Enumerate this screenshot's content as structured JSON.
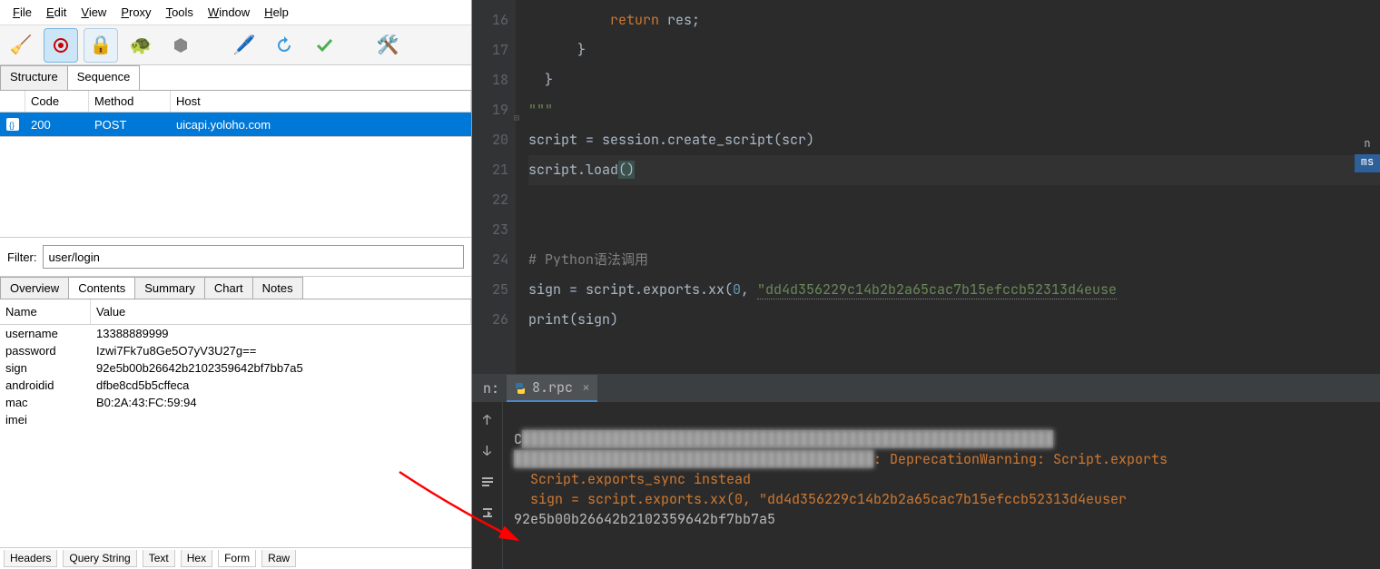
{
  "menu": [
    "File",
    "Edit",
    "View",
    "Proxy",
    "Tools",
    "Window",
    "Help"
  ],
  "toolbar_icons": [
    "broom",
    "record",
    "lock",
    "turtle",
    "hex",
    "pencil",
    "refresh",
    "check",
    "wrench"
  ],
  "view_tabs": {
    "items": [
      "Structure",
      "Sequence"
    ],
    "selected": 1
  },
  "request_table": {
    "columns": {
      "code": "Code",
      "method": "Method",
      "host": "Host"
    },
    "rows": [
      {
        "code": "200",
        "method": "POST",
        "host": "uicapi.yoloho.com"
      }
    ]
  },
  "filter": {
    "label": "Filter:",
    "value": "user/login"
  },
  "detail_tabs": {
    "items": [
      "Overview",
      "Contents",
      "Summary",
      "Chart",
      "Notes"
    ],
    "selected": 1
  },
  "nv_table": {
    "columns": {
      "name": "Name",
      "value": "Value"
    },
    "rows": [
      {
        "name": "username",
        "value": "13388889999"
      },
      {
        "name": "password",
        "value": "Izwi7Fk7u8Ge5O7yV3U27g=="
      },
      {
        "name": "sign",
        "value": "92e5b00b26642b2102359642bf7bb7a5"
      },
      {
        "name": "androidid",
        "value": "dfbe8cd5b5cffeca"
      },
      {
        "name": "mac",
        "value": "B0:2A:43:FC:59:94"
      },
      {
        "name": "imei",
        "value": ""
      }
    ]
  },
  "bottom_tabs": {
    "items": [
      "Headers",
      "Query String",
      "Text",
      "Hex",
      "Form",
      "Raw"
    ],
    "selected": 4
  },
  "editor": {
    "first_line_no": 16,
    "lines": [
      {
        "n": 16,
        "indent": 10,
        "tokens": [
          {
            "t": "return ",
            "c": "kw"
          },
          {
            "t": "res;",
            "c": ""
          }
        ]
      },
      {
        "n": 17,
        "indent": 6,
        "tokens": [
          {
            "t": "}",
            "c": ""
          }
        ]
      },
      {
        "n": 18,
        "indent": 2,
        "tokens": [
          {
            "t": "}",
            "c": ""
          }
        ]
      },
      {
        "n": 19,
        "indent": 0,
        "tokens": [
          {
            "t": "\"\"\"",
            "c": "str"
          }
        ],
        "fold": true
      },
      {
        "n": 20,
        "indent": 0,
        "tokens": [
          {
            "t": "script = session.create_script(scr)",
            "c": ""
          }
        ]
      },
      {
        "n": 21,
        "indent": 0,
        "tokens": [
          {
            "t": "script.load",
            "c": ""
          },
          {
            "t": "(",
            "c": "paren"
          },
          {
            "t": ")",
            "c": "paren"
          }
        ],
        "current": true
      },
      {
        "n": 22,
        "indent": 0,
        "tokens": []
      },
      {
        "n": 23,
        "indent": 0,
        "tokens": []
      },
      {
        "n": 24,
        "indent": 0,
        "tokens": [
          {
            "t": "# Python语法调用",
            "c": "cmt"
          }
        ]
      },
      {
        "n": 25,
        "indent": 0,
        "tokens": [
          {
            "t": "sign = script.exports.xx(",
            "c": ""
          },
          {
            "t": "0",
            "c": "num"
          },
          {
            "t": ", ",
            "c": ""
          },
          {
            "t": "\"dd4d356229c14b2b2a65cac7b15efccb52313d4euse",
            "c": "str",
            "u": true
          }
        ]
      },
      {
        "n": 26,
        "indent": 0,
        "tokens": [
          {
            "t": "print",
            "c": ""
          },
          {
            "t": "(sign)",
            "c": ""
          }
        ]
      }
    ]
  },
  "right_sidebar_tags": [
    "n",
    "ms"
  ],
  "console": {
    "tab_prefix": "n:",
    "tab_label": "8.rpc",
    "blurred_cmd": "C:\\...\\python.exe ... /path/to/8.rpc.py",
    "warn_line1_tail": ": DeprecationWarning: Script.exports ",
    "warn_line2": "Script.exports_sync instead",
    "warn_line3": "  sign = script.exports.xx(0, \"dd4d356229c14b2b2a65cac7b15efccb52313d4euser",
    "output_hash": "92e5b00b26642b2102359642bf7bb7a5"
  }
}
